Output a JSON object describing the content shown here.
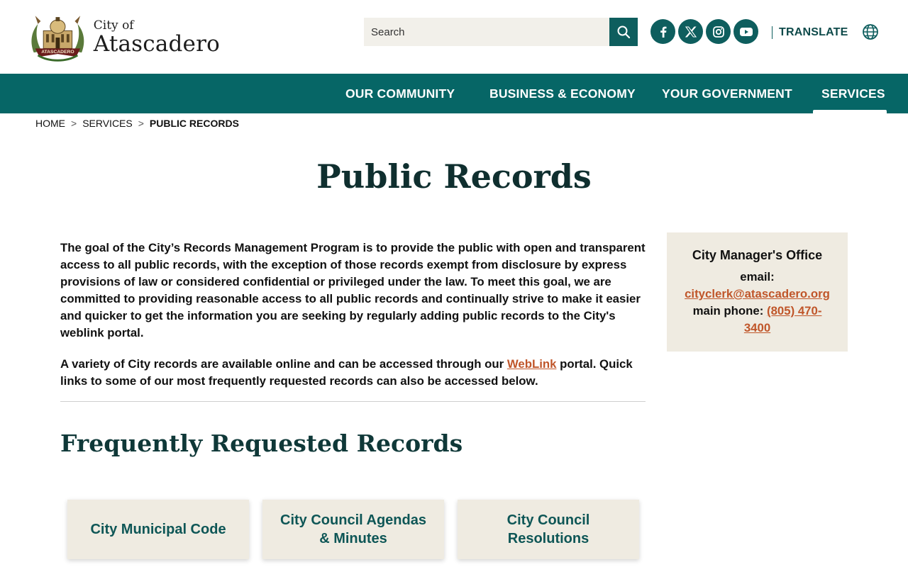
{
  "header": {
    "logo": {
      "line1": "City of",
      "line2": "Atascadero",
      "seal_text": "ATASCADERO"
    },
    "search": {
      "placeholder": "Search"
    },
    "socials": [
      "facebook-icon",
      "x-icon",
      "instagram-icon",
      "youtube-icon"
    ],
    "translate_label": "TRANSLATE"
  },
  "nav": {
    "items": [
      {
        "label": "OUR COMMUNITY"
      },
      {
        "label": "BUSINESS & ECONOMY"
      },
      {
        "label": "YOUR GOVERNMENT"
      },
      {
        "label": "SERVICES",
        "active": true
      }
    ]
  },
  "breadcrumb": {
    "home": "HOME",
    "services": "SERVICES",
    "current": "PUBLIC RECORDS",
    "separator": ">"
  },
  "page": {
    "title": "Public Records",
    "intro": "The goal of the City’s Records Management Program is to provide the public with open and transparent access to all public records, with the exception of those records exempt from disclosure by express provisions of law or considered confidential or privileged under the law.  To meet this goal, we are committed to providing reasonable access to all public records and continually strive to make it easier and quicker to get the information you are seeking by regularly adding public records to the City's weblink portal.",
    "para2_before": "A variety of City records are available online and can be accessed through our ",
    "para2_link": "WebLink",
    "para2_after": " portal. Quick links to some of our most frequently requested records can also be accessed below.",
    "section_title": "Frequently Requested Records",
    "cards": [
      {
        "label": "City Municipal Code"
      },
      {
        "label": "City Council Agendas & Minutes"
      },
      {
        "label": "City Council Resolutions"
      }
    ]
  },
  "sidebar": {
    "title": "City Manager's Office",
    "email_label": "email:",
    "email": "cityclerk@atascadero.org",
    "phone_label": "main phone: ",
    "phone": "(805) 470-3400"
  },
  "colors": {
    "primary_teal": "#066666",
    "button_teal": "#0e5e5e",
    "link_orange": "#c0562a",
    "card_beige": "#efebe1",
    "title_dark": "#0f2f2f"
  }
}
